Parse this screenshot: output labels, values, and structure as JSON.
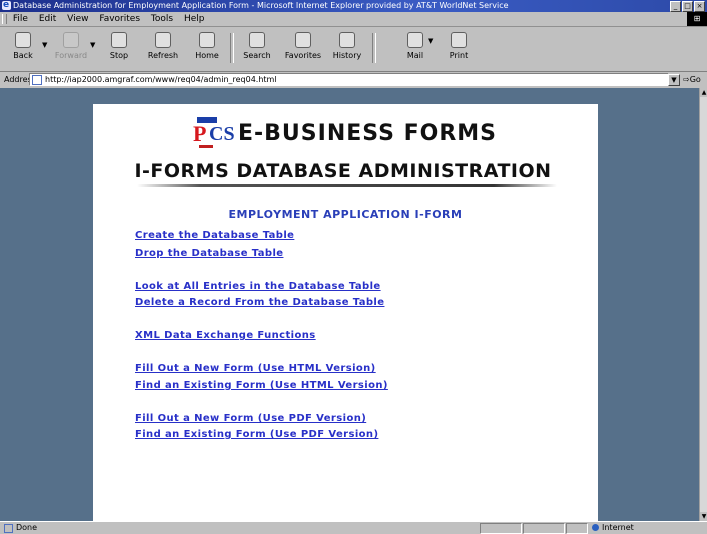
{
  "window": {
    "title": "Database Administration for Employment Application Form - Microsoft Internet Explorer provided by AT&T WorldNet Service",
    "controls": [
      "_",
      "□",
      "×"
    ]
  },
  "menu": {
    "items": [
      "File",
      "Edit",
      "View",
      "Favorites",
      "Tools",
      "Help"
    ]
  },
  "toolbar": {
    "back": "Back",
    "forward": "Forward",
    "stop": "Stop",
    "refresh": "Refresh",
    "home": "Home",
    "search": "Search",
    "favorites": "Favorites",
    "history": "History",
    "mail": "Mail",
    "print": "Print"
  },
  "address": {
    "label": "Address",
    "url": "http://iap2000.amgraf.com/www/req04/admin_req04.html",
    "go": "Go"
  },
  "page": {
    "brand_title": "E-BUSINESS FORMS",
    "banner_title": "I-FORMS DATABASE ADMINISTRATION",
    "section_title": "EMPLOYMENT APPLICATION I-FORM",
    "links": [
      "Create the Database Table",
      "Drop the Database Table",
      "Look at All Entries in the Database Table",
      "Delete a Record From the Database Table",
      "XML Data Exchange Functions",
      "Fill Out a New Form (Use HTML Version)",
      "Find an Existing Form (Use HTML Version)",
      "Fill Out a New Form (Use PDF Version)",
      "Find an Existing Form (Use PDF Version)"
    ]
  },
  "status": {
    "text": "Done",
    "zone": "Internet"
  },
  "colors": {
    "link": "#2830c8",
    "section_title": "#2a3fb8",
    "background": "#56708a",
    "titlebar": "#1c2f8c"
  }
}
